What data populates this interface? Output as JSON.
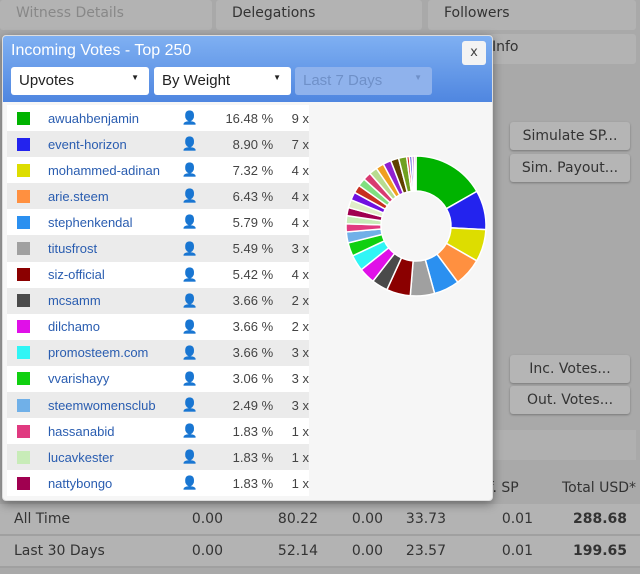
{
  "background": {
    "tabs": [
      "Witness Details",
      "Delegations",
      "Followers"
    ],
    "info_tab": "Info",
    "buttons": [
      "Simulate SP...",
      "Sim. Payout...",
      "Inc. Votes...",
      "Out. Votes..."
    ],
    "summary_headers": [
      "ef. SP",
      "Total USD*"
    ],
    "summary_rows": [
      {
        "label": "All Time",
        "values": [
          "0.00",
          "80.22",
          "0.00",
          "33.73",
          "0.01",
          "288.68"
        ]
      },
      {
        "label": "Last 30 Days",
        "values": [
          "0.00",
          "52.14",
          "0.00",
          "23.57",
          "0.01",
          "199.65"
        ]
      }
    ]
  },
  "modal": {
    "title": "Incoming Votes - Top 250",
    "close_label": "x",
    "filters": {
      "type": "Upvotes",
      "sort": "By Weight",
      "period": "Last 7 Days"
    },
    "voters": [
      {
        "name": "awuahbenjamin",
        "percent": "16.48 %",
        "count": "9 x",
        "color": "#00b300"
      },
      {
        "name": "event-horizon",
        "percent": "8.90 %",
        "count": "7 x",
        "color": "#2323ee"
      },
      {
        "name": "mohammed-adinan",
        "percent": "7.32 %",
        "count": "4 x",
        "color": "#dddd00"
      },
      {
        "name": "arie.steem",
        "percent": "6.43 %",
        "count": "4 x",
        "color": "#ff9040"
      },
      {
        "name": "stephenkendal",
        "percent": "5.79 %",
        "count": "4 x",
        "color": "#2b90f0"
      },
      {
        "name": "titusfrost",
        "percent": "5.49 %",
        "count": "3 x",
        "color": "#a0a0a0"
      },
      {
        "name": "siz-official",
        "percent": "5.42 %",
        "count": "4 x",
        "color": "#8b0000"
      },
      {
        "name": "mcsamm",
        "percent": "3.66 %",
        "count": "2 x",
        "color": "#4a4a4a"
      },
      {
        "name": "dilchamo",
        "percent": "3.66 %",
        "count": "2 x",
        "color": "#e010e8"
      },
      {
        "name": "promosteem.com",
        "percent": "3.66 %",
        "count": "3 x",
        "color": "#30f5f5"
      },
      {
        "name": "vvarishayy",
        "percent": "3.06 %",
        "count": "3 x",
        "color": "#10d010"
      },
      {
        "name": "steemwomensclub",
        "percent": "2.49 %",
        "count": "3 x",
        "color": "#70b0e8"
      },
      {
        "name": "hassanabid",
        "percent": "1.83 %",
        "count": "1 x",
        "color": "#e03a80"
      },
      {
        "name": "lucavkester",
        "percent": "1.83 %",
        "count": "1 x",
        "color": "#c8ecb8"
      },
      {
        "name": "nattybongo",
        "percent": "1.83 %",
        "count": "1 x",
        "color": "#a00050"
      }
    ]
  },
  "chart_data": {
    "type": "pie",
    "donut": true,
    "values": [
      16.48,
      8.9,
      7.32,
      6.43,
      5.79,
      5.49,
      5.42,
      3.66,
      3.66,
      3.66,
      3.06,
      2.49,
      1.83,
      1.83,
      1.83,
      1.83,
      1.83,
      1.83,
      1.83,
      1.83,
      1.83,
      1.83,
      1.83,
      1.83,
      1.83,
      0.6,
      0.6,
      0.5,
      0.4
    ],
    "colors": [
      "#00b300",
      "#2323ee",
      "#dddd00",
      "#ff9040",
      "#2b90f0",
      "#a0a0a0",
      "#8b0000",
      "#4a4a4a",
      "#e010e8",
      "#30f5f5",
      "#10d010",
      "#70b0e8",
      "#e03a80",
      "#c8ecb8",
      "#a00050",
      "#e0eec8",
      "#7010e0",
      "#c83020",
      "#80e080",
      "#d83a70",
      "#b8dc90",
      "#f0a020",
      "#9020d0",
      "#604000",
      "#70a020",
      "#d02020",
      "#6060e0",
      "#a040c0",
      "#e0a0a0"
    ]
  }
}
